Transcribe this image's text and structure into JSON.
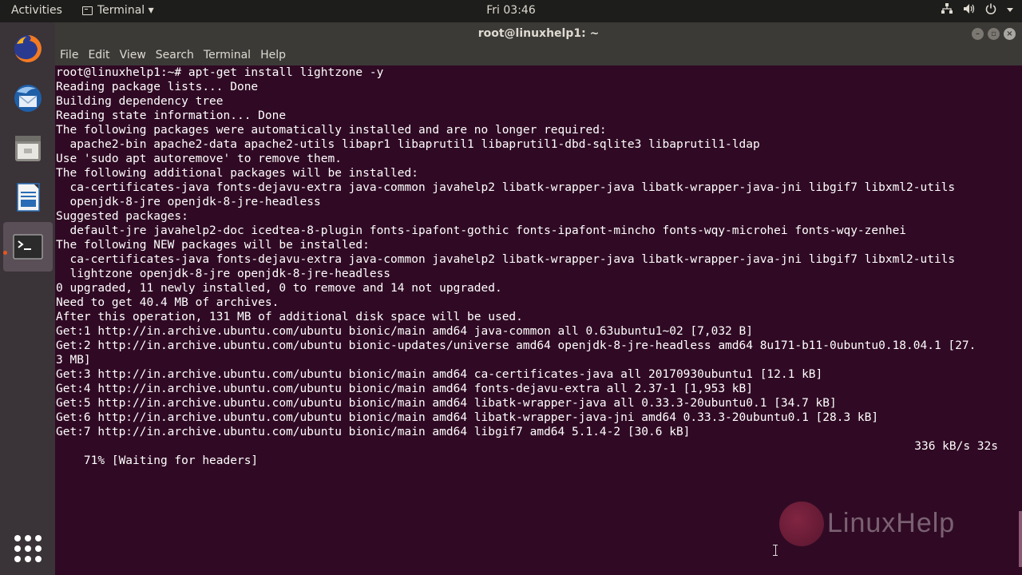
{
  "topbar": {
    "activities": "Activities",
    "app_menu": "Terminal ▾",
    "clock": "Fri 03:46",
    "tray_icons": [
      "network-icon",
      "volume-icon",
      "power-icon",
      "menu-caret-icon"
    ]
  },
  "dock": {
    "items": [
      "firefox",
      "thunderbird",
      "files",
      "libreoffice-writer",
      "terminal"
    ],
    "active_item": "terminal"
  },
  "window": {
    "title": "root@linuxhelp1: ~",
    "menu": [
      "File",
      "Edit",
      "View",
      "Search",
      "Terminal",
      "Help"
    ]
  },
  "terminal": {
    "lines": [
      "root@linuxhelp1:~# apt-get install lightzone -y",
      "Reading package lists... Done",
      "Building dependency tree",
      "Reading state information... Done",
      "The following packages were automatically installed and are no longer required:",
      "  apache2-bin apache2-data apache2-utils libapr1 libaprutil1 libaprutil1-dbd-sqlite3 libaprutil1-ldap",
      "Use 'sudo apt autoremove' to remove them.",
      "The following additional packages will be installed:",
      "  ca-certificates-java fonts-dejavu-extra java-common javahelp2 libatk-wrapper-java libatk-wrapper-java-jni libgif7 libxml2-utils",
      "  openjdk-8-jre openjdk-8-jre-headless",
      "Suggested packages:",
      "  default-jre javahelp2-doc icedtea-8-plugin fonts-ipafont-gothic fonts-ipafont-mincho fonts-wqy-microhei fonts-wqy-zenhei",
      "The following NEW packages will be installed:",
      "  ca-certificates-java fonts-dejavu-extra java-common javahelp2 libatk-wrapper-java libatk-wrapper-java-jni libgif7 libxml2-utils",
      "  lightzone openjdk-8-jre openjdk-8-jre-headless",
      "0 upgraded, 11 newly installed, 0 to remove and 14 not upgraded.",
      "Need to get 40.4 MB of archives.",
      "After this operation, 131 MB of additional disk space will be used.",
      "Get:1 http://in.archive.ubuntu.com/ubuntu bionic/main amd64 java-common all 0.63ubuntu1~02 [7,032 B]",
      "Get:2 http://in.archive.ubuntu.com/ubuntu bionic-updates/universe amd64 openjdk-8-jre-headless amd64 8u171-b11-0ubuntu0.18.04.1 [27.",
      "3 MB]",
      "Get:3 http://in.archive.ubuntu.com/ubuntu bionic/main amd64 ca-certificates-java all 20170930ubuntu1 [12.1 kB]",
      "Get:4 http://in.archive.ubuntu.com/ubuntu bionic/main amd64 fonts-dejavu-extra all 2.37-1 [1,953 kB]",
      "Get:5 http://in.archive.ubuntu.com/ubuntu bionic/main amd64 libatk-wrapper-java all 0.33.3-20ubuntu0.1 [34.7 kB]",
      "Get:6 http://in.archive.ubuntu.com/ubuntu bionic/main amd64 libatk-wrapper-java-jni amd64 0.33.3-20ubuntu0.1 [28.3 kB]",
      "Get:7 http://in.archive.ubuntu.com/ubuntu bionic/main amd64 libgif7 amd64 5.1.4-2 [30.6 kB]"
    ],
    "progress_left": "71% [Waiting for headers]",
    "progress_right": "336 kB/s 32s"
  },
  "watermark": "LinuxHelp",
  "colors": {
    "terminal_bg": "#300a24",
    "topbar_bg": "#1d1d1b",
    "dock_bg": "#3a3338",
    "accent": "#e95420"
  }
}
